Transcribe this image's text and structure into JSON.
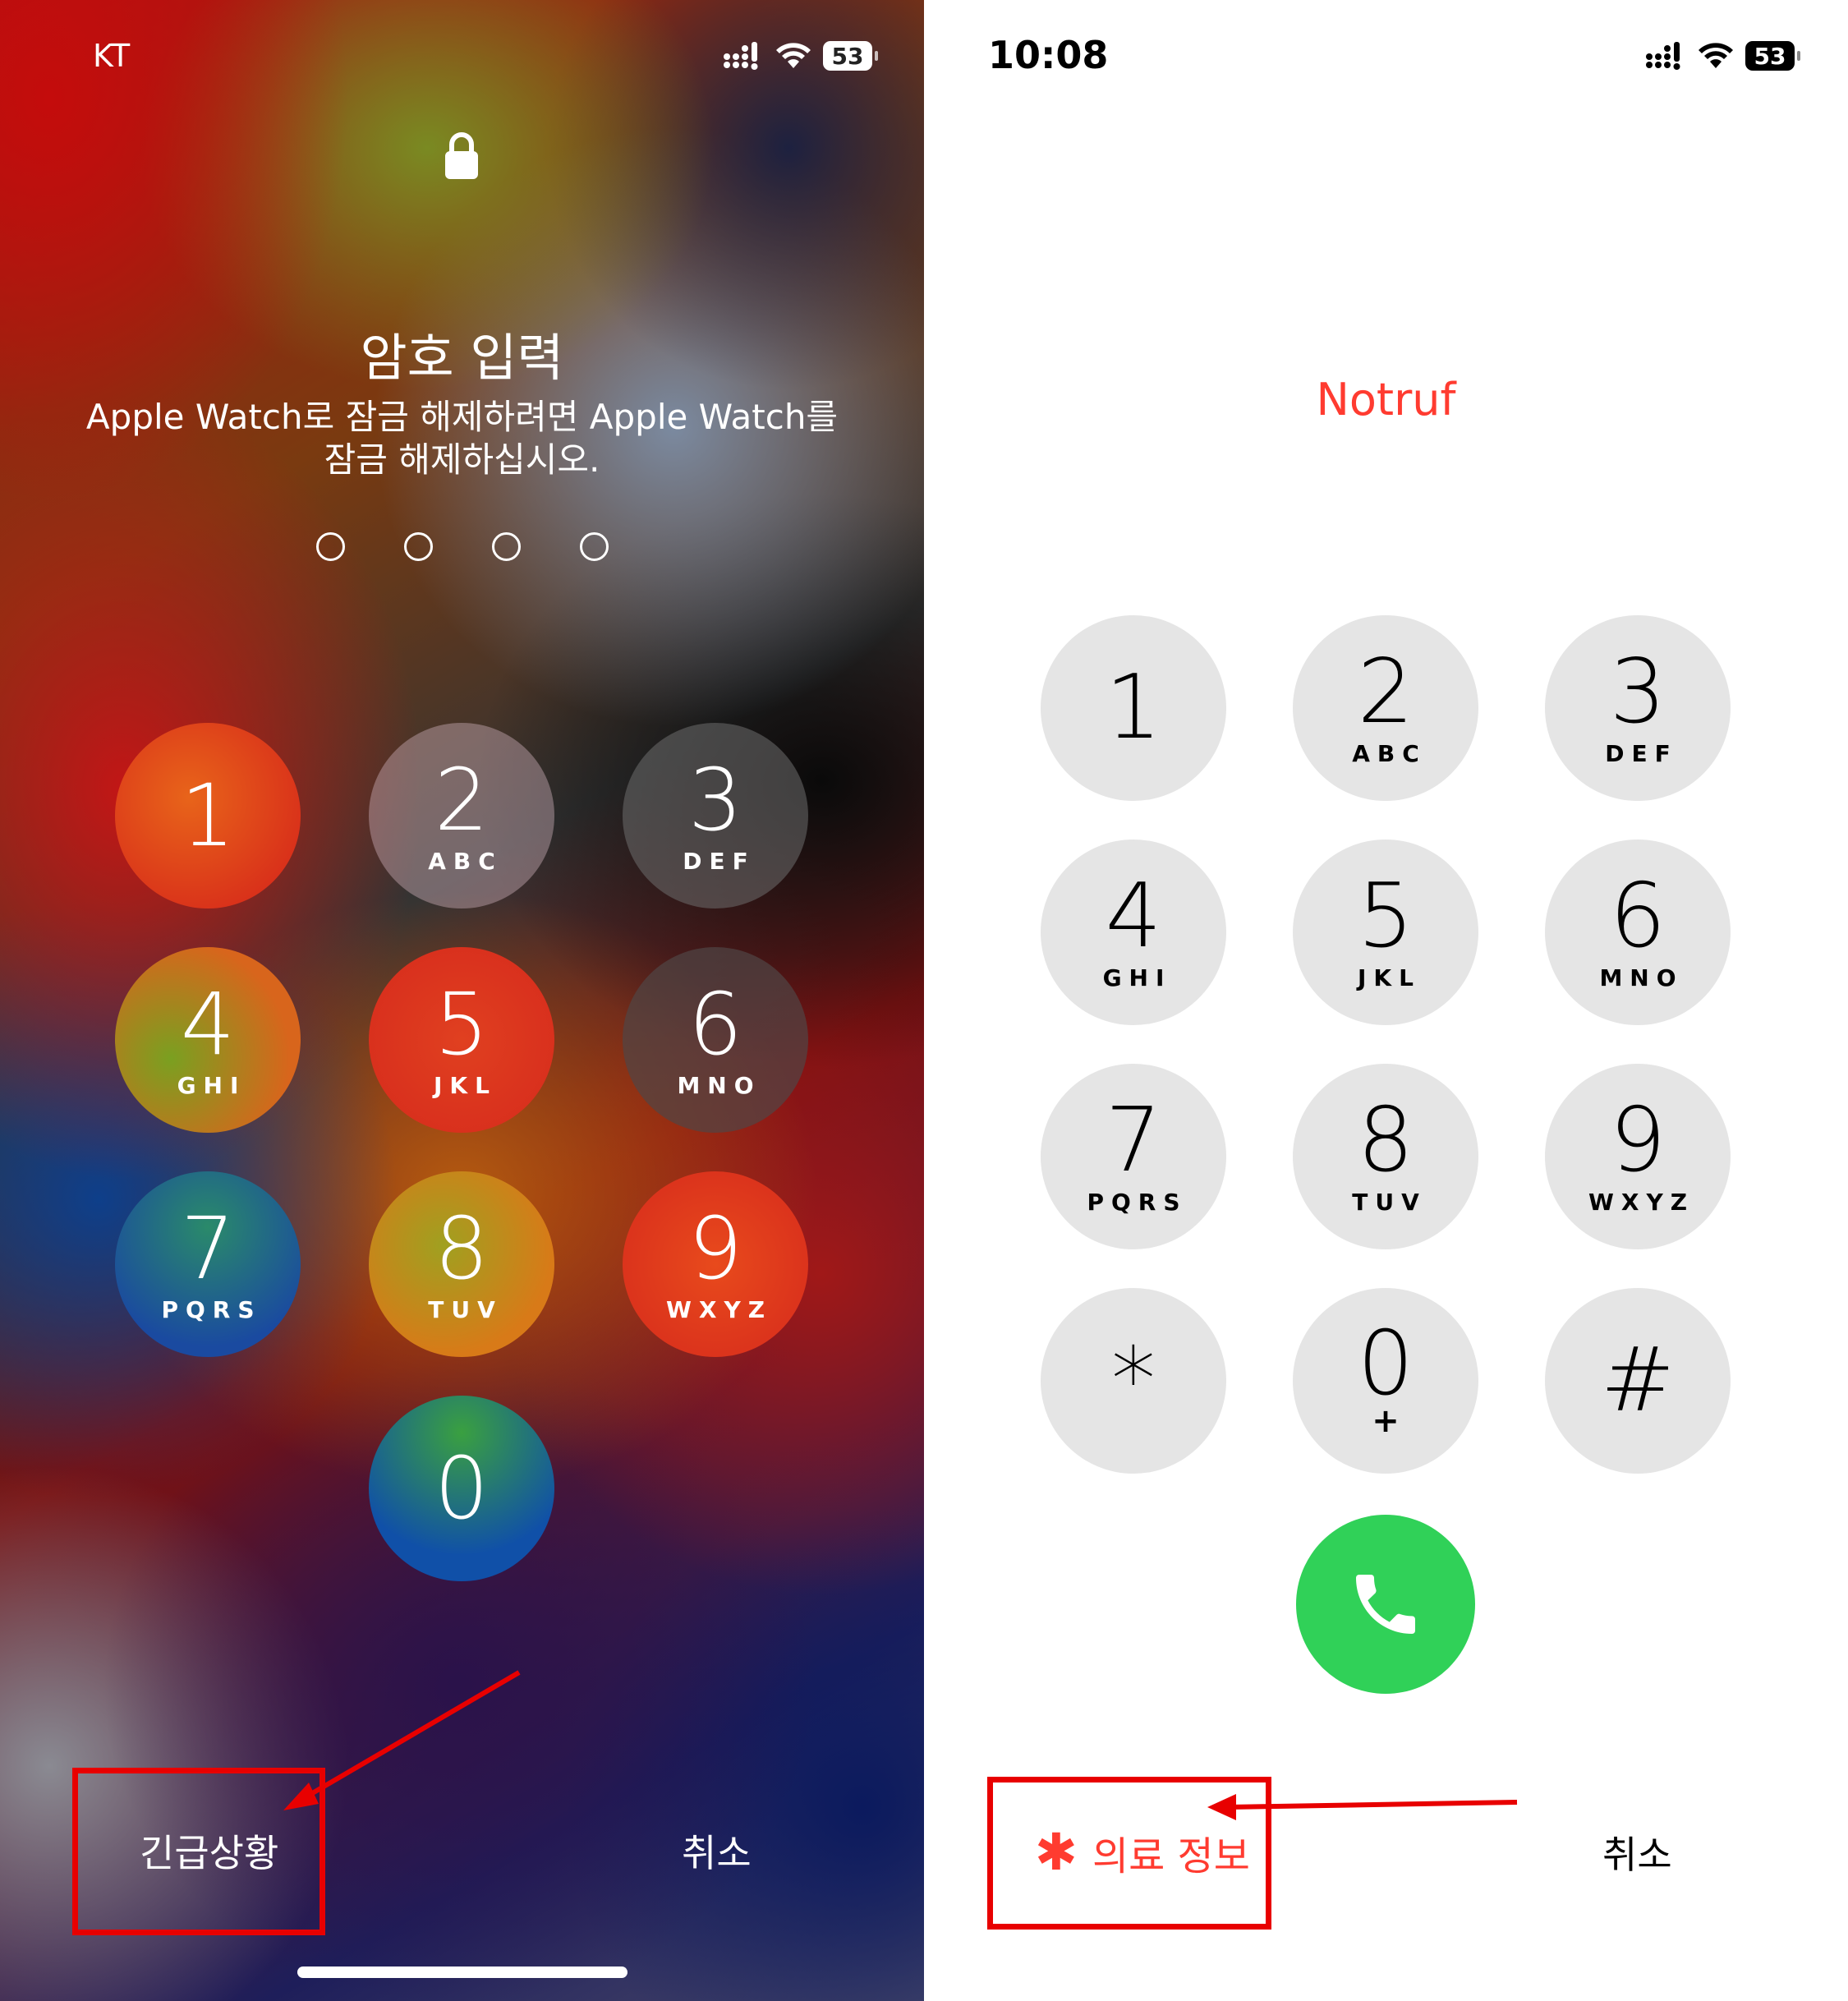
{
  "left_screen": {
    "status_bar": {
      "carrier": "KT",
      "battery": "53",
      "icons": [
        "signal-icon",
        "wifi-icon",
        "battery-icon"
      ]
    },
    "title": "암호 입력",
    "subtitle_line1": "Apple Watch로 잠금 해제하려면 Apple Watch를",
    "subtitle_line2": "잠금 해제하십시오.",
    "passcode_length": 4,
    "keys": [
      {
        "digit": "1",
        "letters": ""
      },
      {
        "digit": "2",
        "letters": "ABC"
      },
      {
        "digit": "3",
        "letters": "DEF"
      },
      {
        "digit": "4",
        "letters": "GHI"
      },
      {
        "digit": "5",
        "letters": "JKL"
      },
      {
        "digit": "6",
        "letters": "MNO"
      },
      {
        "digit": "7",
        "letters": "PQRS"
      },
      {
        "digit": "8",
        "letters": "TUV"
      },
      {
        "digit": "9",
        "letters": "WXYZ"
      },
      {
        "digit": "0",
        "letters": ""
      }
    ],
    "emergency_label": "긴급상황",
    "cancel_label": "취소"
  },
  "right_screen": {
    "status_bar": {
      "time": "10:08",
      "battery": "53",
      "icons": [
        "signal-icon",
        "wifi-icon",
        "battery-icon"
      ]
    },
    "header": "Notruf",
    "keys": [
      {
        "digit": "1",
        "letters": ""
      },
      {
        "digit": "2",
        "letters": "ABC"
      },
      {
        "digit": "3",
        "letters": "DEF"
      },
      {
        "digit": "4",
        "letters": "GHI"
      },
      {
        "digit": "5",
        "letters": "JKL"
      },
      {
        "digit": "6",
        "letters": "MNO"
      },
      {
        "digit": "7",
        "letters": "PQRS"
      },
      {
        "digit": "8",
        "letters": "TUV"
      },
      {
        "digit": "9",
        "letters": "WXYZ"
      },
      {
        "digit": "*",
        "letters": ""
      },
      {
        "digit": "0",
        "letters": "+"
      },
      {
        "digit": "#",
        "letters": ""
      }
    ],
    "call_button_icon": "phone-icon",
    "medical_info_asterisk": "✱",
    "medical_info_label": "의료 정보",
    "cancel_label": "취소"
  },
  "colors": {
    "annotation_red": "#e80000",
    "ios_red": "#ff3b30",
    "call_green": "#30d158",
    "dial_key_gray": "#e5e5e5"
  }
}
